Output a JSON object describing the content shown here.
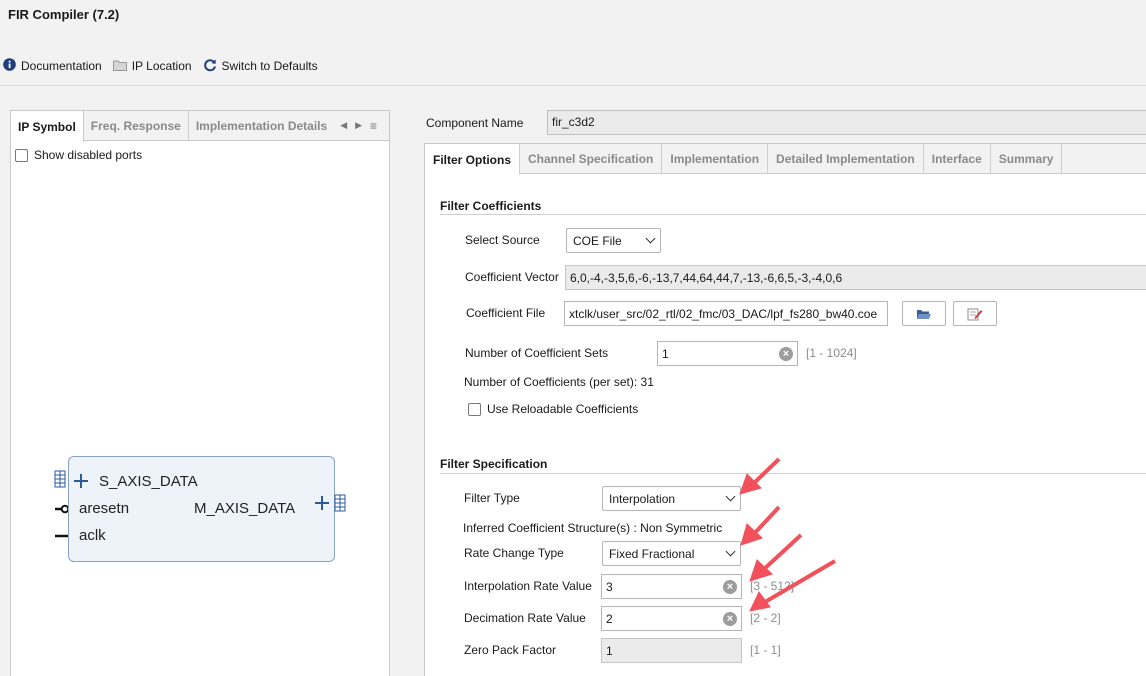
{
  "window": {
    "title": "FIR Compiler (7.2)"
  },
  "toolbar": {
    "documentation": "Documentation",
    "ip_location": "IP Location",
    "switch_defaults": "Switch to Defaults"
  },
  "left": {
    "tabs": [
      "IP Symbol",
      "Freq. Response",
      "Implementation Details"
    ],
    "show_disabled": "Show disabled ports",
    "symbol": {
      "s_axis": "S_AXIS_DATA",
      "aresetn": "aresetn",
      "aclk": "aclk",
      "m_axis": "M_AXIS_DATA"
    }
  },
  "component": {
    "label": "Component Name",
    "value": "fir_c3d2"
  },
  "right_tabs": [
    "Filter Options",
    "Channel Specification",
    "Implementation",
    "Detailed Implementation",
    "Interface",
    "Summary"
  ],
  "coeff": {
    "section": "Filter Coefficients",
    "select_source_label": "Select Source",
    "select_source_value": "COE File",
    "vector_label": "Coefficient Vector",
    "vector_value": "6,0,-4,-3,5,6,-6,-13,7,44,64,44,7,-13,-6,6,5,-3,-4,0,6",
    "file_label": "Coefficient File",
    "file_value": "xtclk/user_src/02_rtl/02_fmc/03_DAC/lpf_fs280_bw40.coe",
    "sets_label": "Number of Coefficient Sets",
    "sets_value": "1",
    "sets_range": "[1 - 1024]",
    "num_coeffs": "Number of Coefficients (per set): 31",
    "reloadable": "Use Reloadable Coefficients"
  },
  "spec": {
    "section": "Filter Specification",
    "type_label": "Filter Type",
    "type_value": "Interpolation",
    "inferred": "Inferred Coefficient Structure(s) : Non Symmetric",
    "rate_type_label": "Rate Change Type",
    "rate_type_value": "Fixed Fractional",
    "interp_label": "Interpolation Rate Value",
    "interp_value": "3",
    "interp_range": "[3 - 512]",
    "decim_label": "Decimation Rate Value",
    "decim_value": "2",
    "decim_range": "[2 - 2]",
    "zero_label": "Zero Pack Factor",
    "zero_value": "1",
    "zero_range": "[1 - 1]"
  },
  "colors": {
    "annotation_arrow": "#f2505a",
    "symbol_fill": "#eef3f9",
    "symbol_border": "#8aa4c0"
  }
}
